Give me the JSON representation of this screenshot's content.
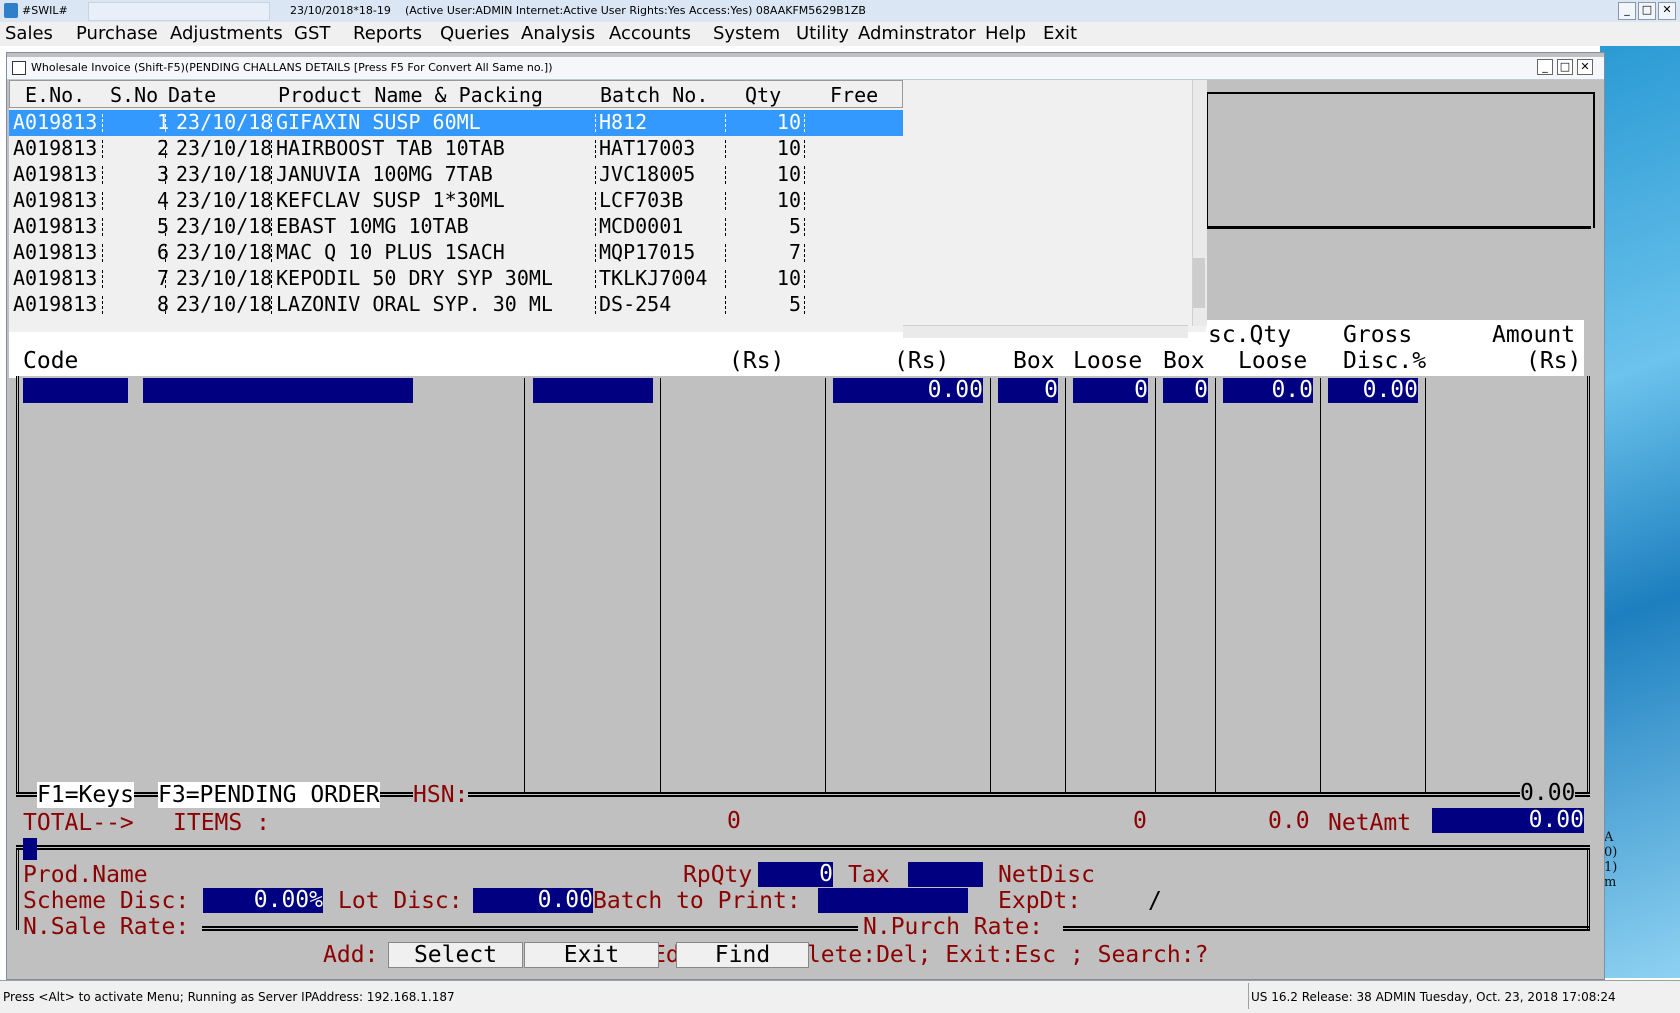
{
  "titlebar": {
    "app": "#SWIL#",
    "date_year": "23/10/2018*18-19",
    "info": "(Active User:ADMIN Internet:Active  User Rights:Yes Access:Yes) 08AAKFM5629B1ZB",
    "min": "_",
    "max": "□",
    "close": "✕"
  },
  "menu": [
    "Sales",
    "Purchase",
    "Adjustments",
    "GST",
    "Reports",
    "Queries",
    "Analysis",
    "Accounts",
    "System",
    "Utility",
    "Adminstrator",
    "Help",
    "Exit"
  ],
  "child": {
    "title": "Wholesale Invoice (Shift-F5)(PENDING CHALLANS DETAILS [Press F5 For Convert All Same no.])",
    "min": "_",
    "max": "□",
    "close": "✕"
  },
  "pending": {
    "columns": {
      "eno": "E.No.",
      "sno": "S.No",
      "date": "Date",
      "product": "Product Name & Packing",
      "batch": "Batch No.",
      "qty": "Qty",
      "free": "Free"
    },
    "rows": [
      {
        "eno": "A019813",
        "sno": "1",
        "date": "23/10/18",
        "product": "GIFAXIN SUSP 60ML",
        "batch": "H812",
        "qty": "10"
      },
      {
        "eno": "A019813",
        "sno": "2",
        "date": "23/10/18",
        "product": "HAIRBOOST TAB 10TAB",
        "batch": "HAT17003",
        "qty": "10"
      },
      {
        "eno": "A019813",
        "sno": "3",
        "date": "23/10/18",
        "product": "JANUVIA 100MG 7TAB",
        "batch": "JVC18005",
        "qty": "10"
      },
      {
        "eno": "A019813",
        "sno": "4",
        "date": "23/10/18",
        "product": "KEFCLAV SUSP 1*30ML",
        "batch": "LCF703B",
        "qty": "10"
      },
      {
        "eno": "A019813",
        "sno": "5",
        "date": "23/10/18",
        "product": "EBAST 10MG 10TAB",
        "batch": "MCD0001",
        "qty": "5"
      },
      {
        "eno": "A019813",
        "sno": "6",
        "date": "23/10/18",
        "product": "MAC Q 10 PLUS 1SACH",
        "batch": "MQP17015",
        "qty": "7"
      },
      {
        "eno": "A019813",
        "sno": "7",
        "date": "23/10/18",
        "product": "KEPODIL 50 DRY SYP 30ML",
        "batch": "TKLKJ7004",
        "qty": "10"
      },
      {
        "eno": "A019813",
        "sno": "8",
        "date": "23/10/18",
        "product": "LAZONIV ORAL SYP. 30 ML",
        "batch": "DS-254",
        "qty": "5"
      }
    ],
    "selected_index": 0
  },
  "grid": {
    "headers": {
      "code": "Code",
      "rs1": "(Rs)",
      "rs2": "(Rs)",
      "box1": "Box",
      "loose1": "Loose",
      "box2": "Box",
      "scqty": "sc.Qty",
      "loose2": "Loose",
      "gross": "Gross",
      "disc": "Disc.%",
      "amount": "Amount",
      "rs3": "(Rs)"
    },
    "entry": {
      "rate": "0.00",
      "box": "0",
      "loose": "0",
      "box2": "0",
      "scqty": "0.0",
      "disc": "0.00"
    }
  },
  "keys_line": {
    "f1": "F1=Keys",
    "f3": "F3=PENDING ORDER",
    "hsn": "HSN:",
    "amount": "0.00"
  },
  "total": {
    "label": "TOTAL-->",
    "items_label": "ITEMS :",
    "items": "0",
    "loose": "0",
    "scqty": "0.0",
    "netamt_label": "NetAmt",
    "netamt": "0.00"
  },
  "info": {
    "prod_name_label": "Prod.Name",
    "rpqty_label": "RpQty",
    "rpqty": "0",
    "tax_label": "Tax",
    "netdisc_label": "NetDisc",
    "scheme_label": "Scheme Disc:",
    "scheme": "0.00%",
    "lot_label": "Lot Disc:",
    "lot": "0.00",
    "batch_print_label": "Batch to Print:",
    "expdt_label": "ExpDt:",
    "expdt": "/",
    "nsale_label": "N.Sale Rate:",
    "npurch_label": "N.Purch Rate:"
  },
  "bottom": {
    "add_label": "Add:",
    "select": "Select",
    "exit": "Exit",
    "find": "Find",
    "hint_ed": "Ed",
    "hint_rest": "elete:Del; Exit:Esc ; Search:?"
  },
  "desk_text": "A\n0)\n1)\nm",
  "status": {
    "left": "Press <Alt> to activate Menu; Running as Server IPAddress: 192.168.1.187",
    "right": "US 16.2 Release: 38 ADMIN  Tuesday, Oct. 23, 2018  17:08:24"
  }
}
